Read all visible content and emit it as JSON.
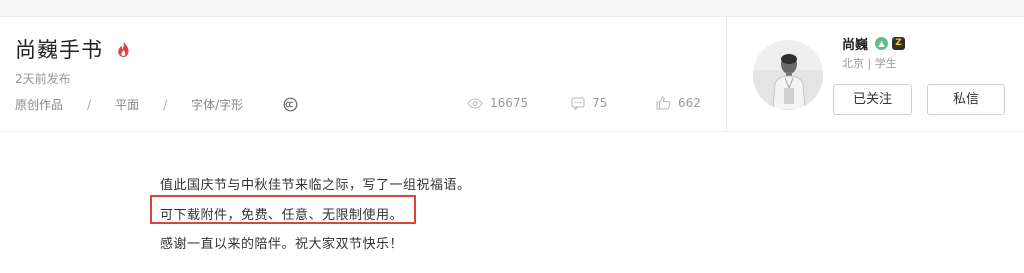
{
  "header": {
    "title": "尚巍手书",
    "published": "2天前发布",
    "meta": {
      "category1": "原创作品",
      "separator": "/",
      "category2": "平面",
      "category3": "字体/字形"
    },
    "stats": {
      "views": "16675",
      "comments": "75",
      "likes": "662"
    }
  },
  "author": {
    "name": "尚巍",
    "badge1": "▲",
    "badge2": "Z",
    "info": "北京 | 学生",
    "follow_label": "已关注",
    "message_label": "私信"
  },
  "content": {
    "line1": "值此国庆节与中秋佳节来临之际，写了一组祝福语。",
    "line2": "可下载附件，免费、任意、无限制使用。",
    "line3": "感谢一直以来的陪伴。祝大家双节快乐！"
  },
  "colors": {
    "accent_red": "#d9443c",
    "fire_red": "#e0463c",
    "badge_green": "#5fbf8f"
  },
  "icons": [
    "fire-icon",
    "creative-commons-icon",
    "eye-icon",
    "comment-icon",
    "thumbs-up-icon"
  ]
}
